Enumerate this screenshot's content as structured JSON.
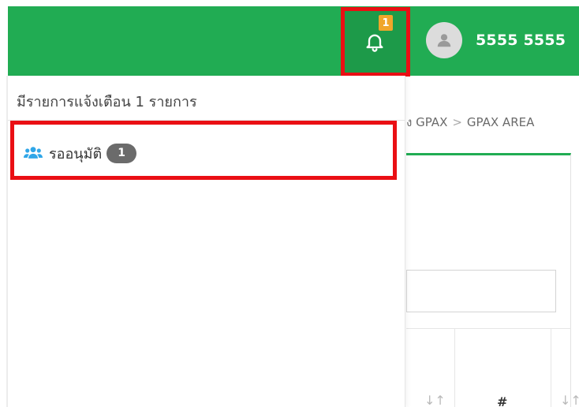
{
  "header": {
    "notification_count": "1",
    "user_name": "5555 5555"
  },
  "breadcrumb": {
    "item_prev": "ง GPAX",
    "separator": ">",
    "item_current": "GPAX AREA"
  },
  "notifications": {
    "summary": "มีรายการแจ้งเตือน 1 รายการ",
    "items": [
      {
        "label": "รออนุมัติ",
        "count": "1",
        "icon": "users-icon"
      }
    ]
  },
  "table": {
    "col_hash": "#",
    "sort_glyph": "↓↑"
  },
  "colors": {
    "navbar": "#21ac53",
    "highlight": "#ea0f14",
    "bell_badge": "#f0a62a",
    "item_icon": "#2fa6e8"
  }
}
